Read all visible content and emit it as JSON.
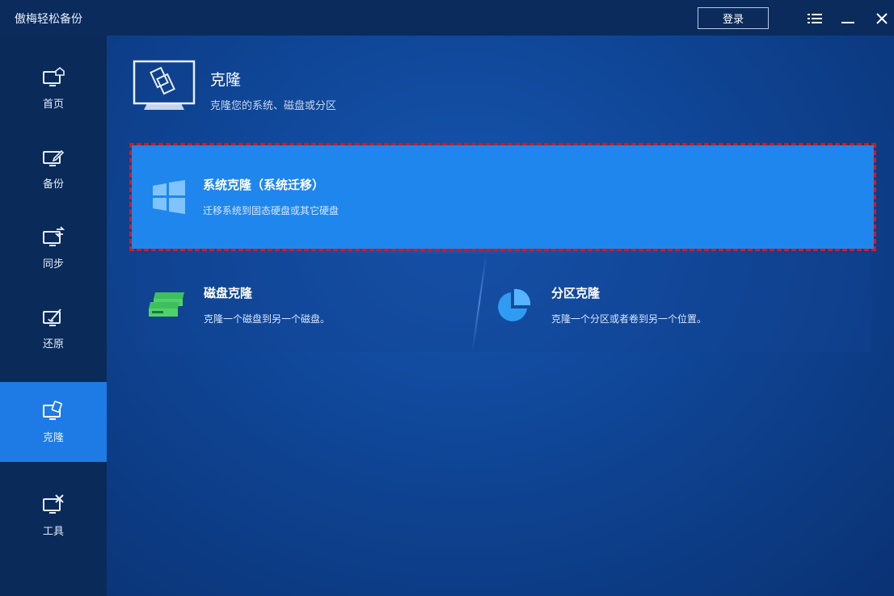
{
  "app": {
    "title": "傲梅轻松备份",
    "login_label": "登录"
  },
  "window_controls": {
    "menu_icon": "menu-icon",
    "minimize_icon": "minimize-icon",
    "close_icon": "close-icon"
  },
  "sidebar": {
    "items": [
      {
        "label": "首页",
        "icon": "home-monitor-icon",
        "active": false
      },
      {
        "label": "备份",
        "icon": "backup-monitor-icon",
        "active": false
      },
      {
        "label": "同步",
        "icon": "sync-monitor-icon",
        "active": false
      },
      {
        "label": "还原",
        "icon": "restore-monitor-icon",
        "active": false
      },
      {
        "label": "克隆",
        "icon": "clone-monitor-icon",
        "active": true
      },
      {
        "label": "工具",
        "icon": "tools-monitor-icon",
        "active": false
      }
    ]
  },
  "main": {
    "title": "克隆",
    "subtitle": "克隆您的系统、磁盘或分区",
    "cards": {
      "system_clone": {
        "title": "系统克隆（系统迁移）",
        "description": "迁移系统到固态硬盘或其它硬盘",
        "icon": "windows-logo-icon"
      },
      "disk_clone": {
        "title": "磁盘克隆",
        "description": "克隆一个磁盘到另一个磁盘。",
        "icon": "disk-icon"
      },
      "partition_clone": {
        "title": "分区克隆",
        "description": "克隆一个分区或者卷到另一个位置。",
        "icon": "pie-partition-icon"
      }
    }
  },
  "colors": {
    "titlebar": "#0a2b5c",
    "sidebar": "#0a2a59",
    "active_nav": "#1e7be6",
    "highlight_card": "#1f86ee",
    "highlight_border": "#d8161e",
    "disk_icon": "#4ed36a",
    "partition_icon": "#2f9cf2"
  }
}
